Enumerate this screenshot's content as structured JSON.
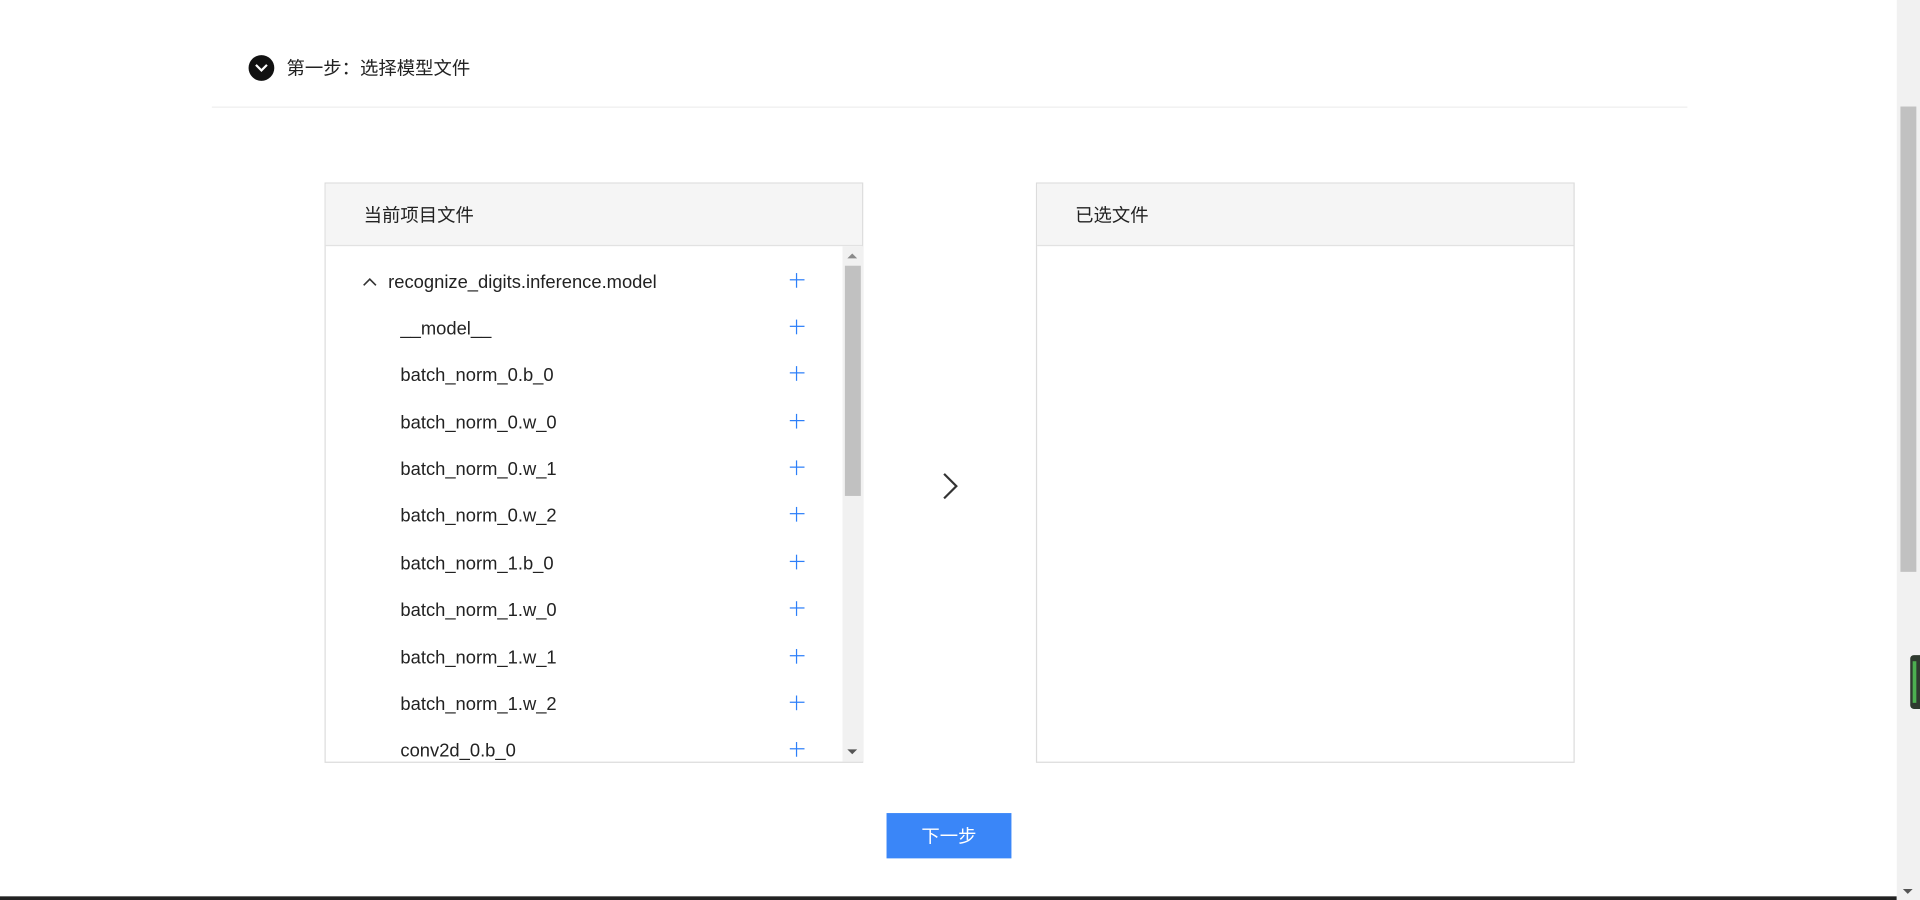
{
  "step": {
    "title": "第一步：选择模型文件"
  },
  "left_panel": {
    "title": "当前项目文件",
    "root": "recognize_digits.inference.model",
    "files": [
      "__model__",
      "batch_norm_0.b_0",
      "batch_norm_0.w_0",
      "batch_norm_0.w_1",
      "batch_norm_0.w_2",
      "batch_norm_1.b_0",
      "batch_norm_1.w_0",
      "batch_norm_1.w_1",
      "batch_norm_1.w_2",
      "conv2d_0.b_0"
    ]
  },
  "right_panel": {
    "title": "已选文件"
  },
  "actions": {
    "next_label": "下一步"
  },
  "icons": {
    "step_toggle": "chevron-down-circle-icon",
    "tree_toggle": "chevron-up-icon",
    "add": "plus-icon",
    "transfer": "chevron-right-icon"
  },
  "colors": {
    "accent": "#3a86f8",
    "plus": "#2d7ff9",
    "panel_head_bg": "#f5f5f5",
    "border": "#dcdcdc"
  }
}
